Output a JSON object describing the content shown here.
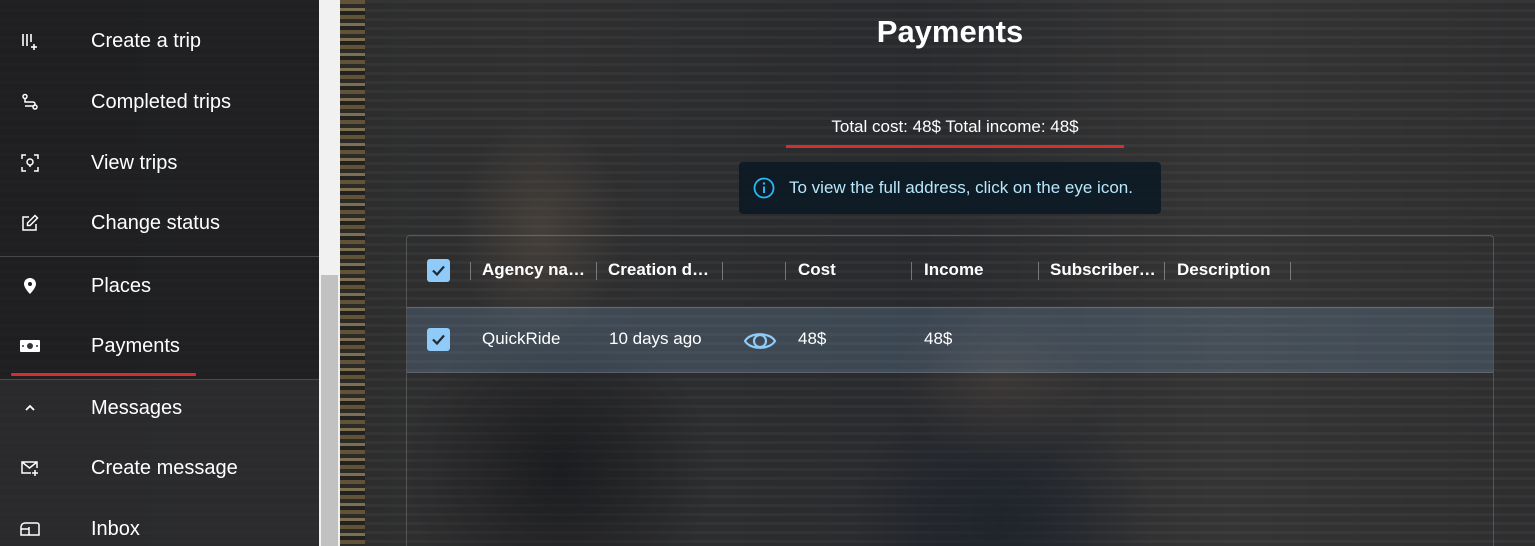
{
  "sidebar": {
    "items": [
      {
        "label": "Create a trip",
        "icon": "create-trip-icon"
      },
      {
        "label": "Completed trips",
        "icon": "route-icon"
      },
      {
        "label": "View trips",
        "icon": "view-trips-icon"
      },
      {
        "label": "Change status",
        "icon": "edit-icon"
      },
      {
        "label": "Places",
        "icon": "location-pin-icon"
      },
      {
        "label": "Payments",
        "icon": "money-icon",
        "active": true
      },
      {
        "label": "Messages",
        "icon": "chevron-up-icon"
      },
      {
        "label": "Create message",
        "icon": "mail-add-icon"
      },
      {
        "label": "Inbox",
        "icon": "inbox-icon"
      }
    ]
  },
  "main": {
    "title": "Payments",
    "totals": "Total cost: 48$ Total income: 48$",
    "info": "To view the full address, click on the eye icon.",
    "grid": {
      "columns": [
        "Agency na…",
        "Creation d…",
        "",
        "Cost",
        "Income",
        "Subscriber…",
        "Description"
      ],
      "rows": [
        {
          "agency": "QuickRide",
          "created": "10 days ago",
          "cost": "48$",
          "income": "48$",
          "subscriber": "",
          "description": "",
          "selected": true
        }
      ]
    }
  },
  "colors": {
    "accent_red": "#d32f2f",
    "checkbox_blue": "#90caf9",
    "info_text": "#b8e6fb"
  }
}
